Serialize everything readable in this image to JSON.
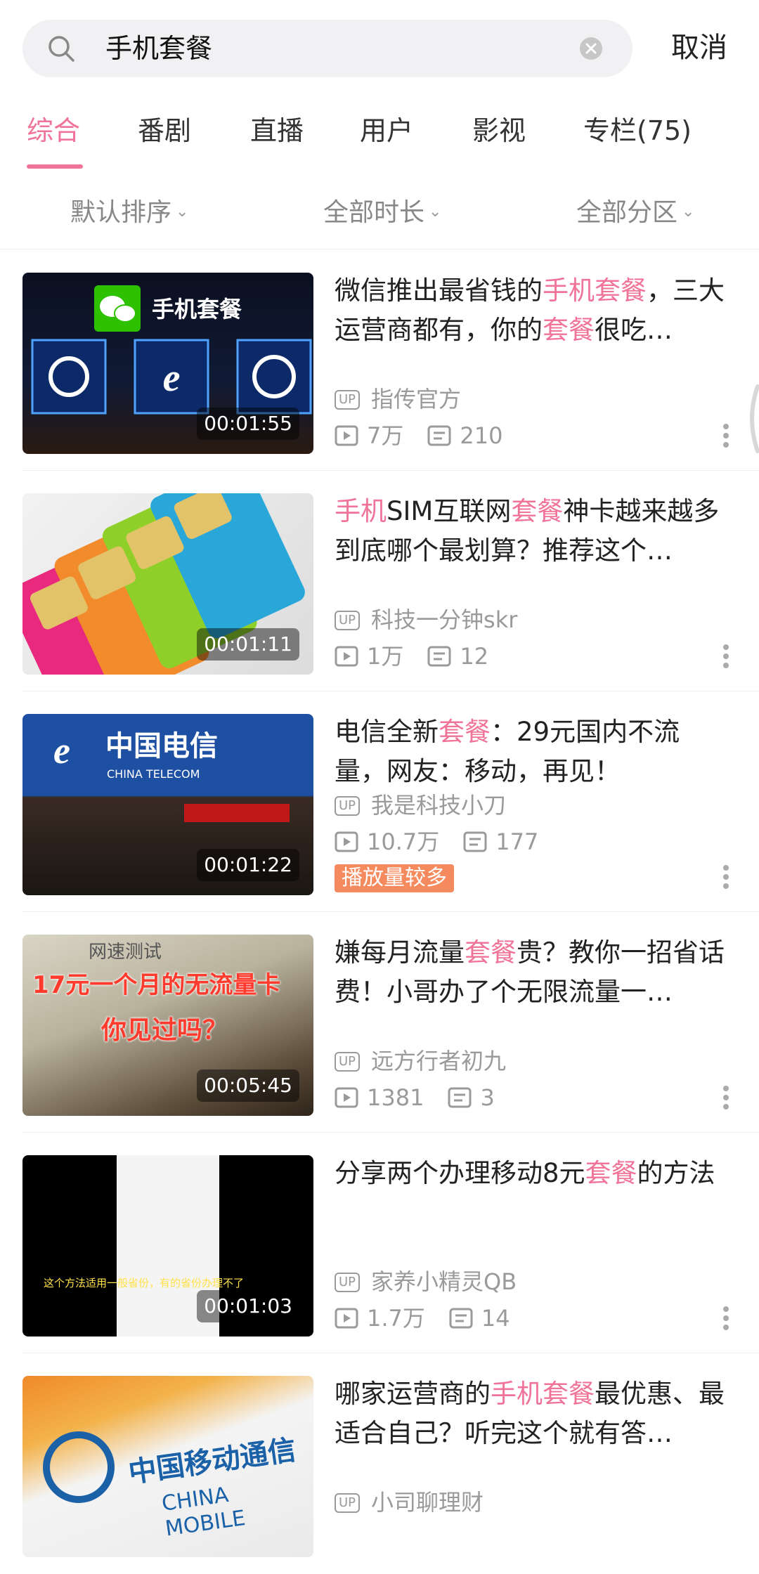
{
  "search": {
    "query": "手机套餐",
    "cancel": "取消"
  },
  "tabs": [
    {
      "label": "综合"
    },
    {
      "label": "番剧"
    },
    {
      "label": "直播"
    },
    {
      "label": "用户"
    },
    {
      "label": "影视"
    },
    {
      "label": "专栏(75)"
    }
  ],
  "filters": [
    {
      "label": "默认排序"
    },
    {
      "label": "全部时长"
    },
    {
      "label": "全部分区"
    }
  ],
  "videos": [
    {
      "title_parts": [
        {
          "t": "微信推出最省钱的",
          "hl": false
        },
        {
          "t": "手机套餐",
          "hl": true
        },
        {
          "t": "，三大运营商都有，你的",
          "hl": false
        },
        {
          "t": "套餐",
          "hl": true
        },
        {
          "t": "很吃…",
          "hl": false
        }
      ],
      "duration": "00:01:55",
      "uploader": "指传官方",
      "views": "7万",
      "comments": "210",
      "thumb_text": "手机套餐"
    },
    {
      "title_parts": [
        {
          "t": "手机",
          "hl": true
        },
        {
          "t": "SIM互联网",
          "hl": false
        },
        {
          "t": "套餐",
          "hl": true
        },
        {
          "t": "神卡越来越多 到底哪个最划算？推荐这个…",
          "hl": false
        }
      ],
      "duration": "00:01:11",
      "uploader": "科技一分钟skr",
      "views": "1万",
      "comments": "12"
    },
    {
      "title_parts": [
        {
          "t": "电信全新",
          "hl": false
        },
        {
          "t": "套餐",
          "hl": true
        },
        {
          "t": "：29元国内不流量，网友：移动，再见！",
          "hl": false
        }
      ],
      "duration": "00:01:22",
      "uploader": "我是科技小刀",
      "views": "10.7万",
      "comments": "177",
      "badge": "播放量较多",
      "thumb_text": "中国电信",
      "thumb_text2": "CHINA TELECOM"
    },
    {
      "title_parts": [
        {
          "t": "嫌每月流量",
          "hl": false
        },
        {
          "t": "套餐",
          "hl": true
        },
        {
          "t": "贵？教你一招省话费！小哥办了个无限流量一…",
          "hl": false
        }
      ],
      "duration": "00:05:45",
      "uploader": "远方行者初九",
      "views": "1381",
      "comments": "3",
      "thumb_text": "网速测试",
      "thumb_text2": "17元一个月的无流量卡",
      "thumb_text3": "你见过吗？"
    },
    {
      "title_parts": [
        {
          "t": "分享两个办理移动8元",
          "hl": false
        },
        {
          "t": "套餐",
          "hl": true
        },
        {
          "t": "的方法",
          "hl": false
        }
      ],
      "duration": "00:01:03",
      "uploader": "家养小精灵QB",
      "views": "1.7万",
      "comments": "14",
      "thumb_text": "这个方法适用一般省份，有的省份办理不了"
    },
    {
      "title_parts": [
        {
          "t": "哪家运营商的",
          "hl": false
        },
        {
          "t": "手机套餐",
          "hl": true
        },
        {
          "t": "最优惠、最适合自己？听完这个就有答…",
          "hl": false
        }
      ],
      "uploader": "小司聊理财",
      "thumb_text": "中国移动通信",
      "thumb_text2": "CHINA MOBILE"
    }
  ],
  "colors": {
    "accent": "#f0749a",
    "badge": "#f48a5d"
  }
}
